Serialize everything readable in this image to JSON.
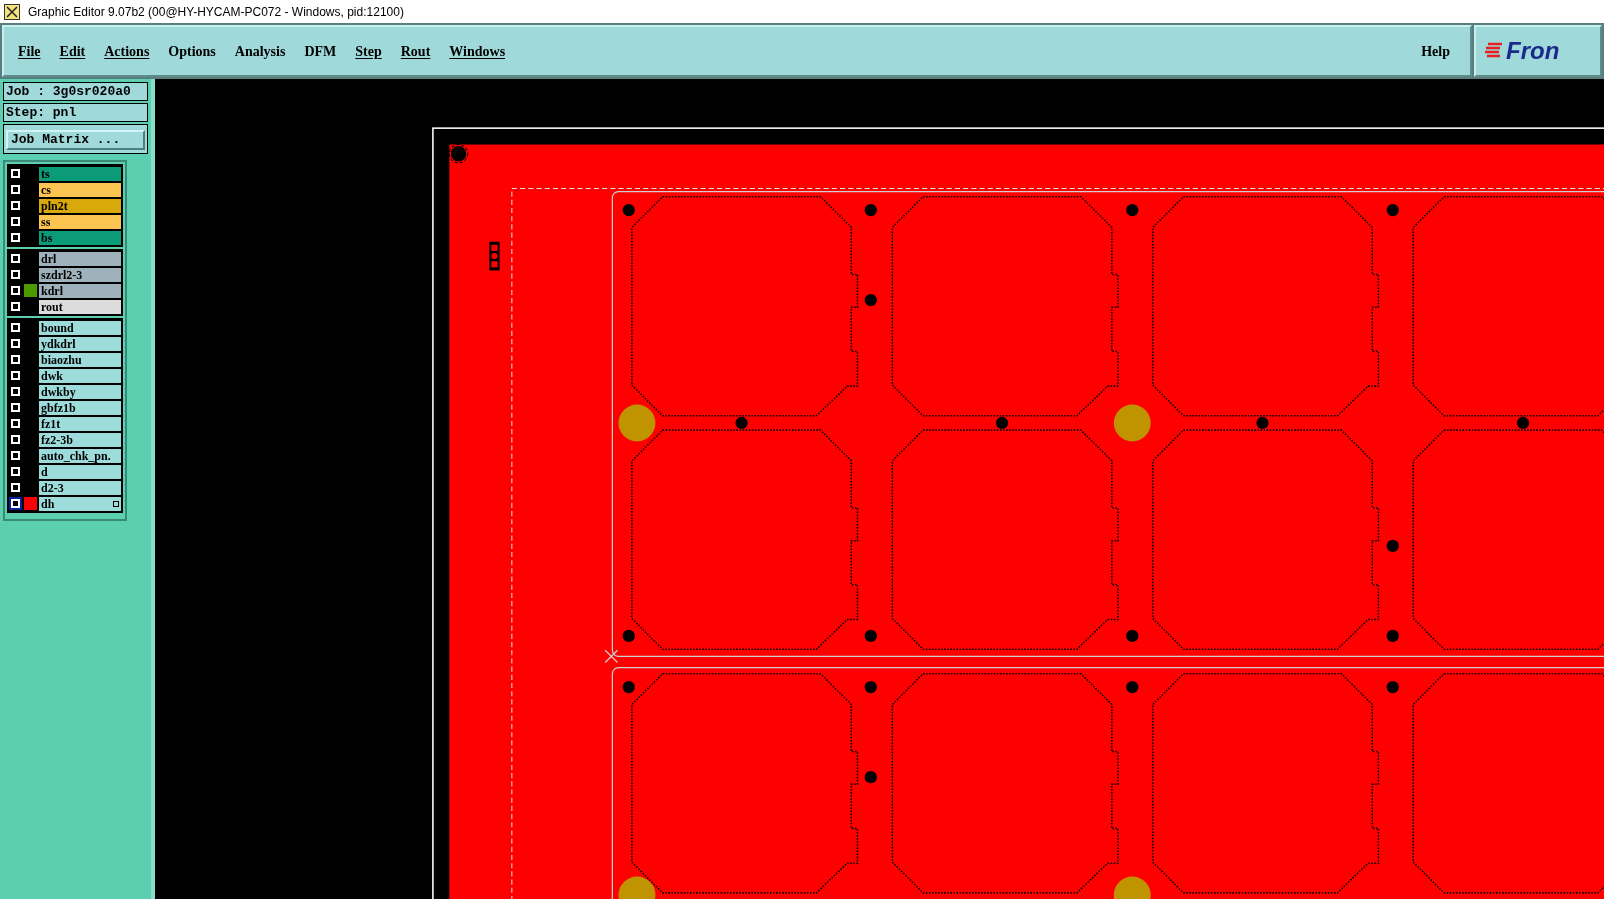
{
  "window": {
    "title": "Graphic Editor 9.07b2 (00@HY-HYCAM-PC072 - Windows, pid:12100)"
  },
  "menu": [
    {
      "label": "File",
      "underline": true
    },
    {
      "label": "Edit",
      "underline": true
    },
    {
      "label": "Actions",
      "underline": true
    },
    {
      "label": "Options",
      "underline": false
    },
    {
      "label": "Analysis",
      "underline": false
    },
    {
      "label": "DFM",
      "underline": false
    },
    {
      "label": "Step",
      "underline": true
    },
    {
      "label": "Rout",
      "underline": true
    },
    {
      "label": "Windows",
      "underline": true
    }
  ],
  "help": "Help",
  "logo": "Fron",
  "job": "Job : 3g0sr020a0",
  "step": "Step: pnl",
  "job_matrix_button": "Job Matrix ...",
  "layer_groups": [
    {
      "layers": [
        {
          "name": "ts",
          "color": "#0c9b78",
          "selected": false
        },
        {
          "name": "cs",
          "color": "#fcc451",
          "selected": false
        },
        {
          "name": "pln2t",
          "color": "#d9a90c",
          "selected": false
        },
        {
          "name": "ss",
          "color": "#fcc451",
          "selected": false
        },
        {
          "name": "bs",
          "color": "#0c9b78",
          "selected": false
        }
      ]
    },
    {
      "layers": [
        {
          "name": "drl",
          "color": "#9fb1ba",
          "selected": false
        },
        {
          "name": "szdrl2-3",
          "color": "#9fb1ba",
          "selected": false
        },
        {
          "name": "kdrl",
          "color": "#9fb1ba",
          "selected": false,
          "swatch": {
            "color": "#4a9a00"
          }
        },
        {
          "name": "rout",
          "color": "#dcdcdc",
          "selected": false
        }
      ]
    },
    {
      "layers": [
        {
          "name": "bound",
          "color": "#9edcdc",
          "selected": false
        },
        {
          "name": "ydkdrl",
          "color": "#9edcdc",
          "selected": false
        },
        {
          "name": "biaozhu",
          "color": "#9edcdc",
          "selected": false
        },
        {
          "name": "dwk",
          "color": "#9edcdc",
          "selected": false
        },
        {
          "name": "dwkby",
          "color": "#9edcdc",
          "selected": false
        },
        {
          "name": "gbfz1b",
          "color": "#9edcdc",
          "selected": false
        },
        {
          "name": "fz1t",
          "color": "#9edcdc",
          "selected": false
        },
        {
          "name": "fz2-3b",
          "color": "#9edcdc",
          "selected": false
        },
        {
          "name": "auto_chk_pn.",
          "color": "#9edcdc",
          "selected": false
        },
        {
          "name": "d",
          "color": "#9edcdc",
          "selected": false
        },
        {
          "name": "d2-3",
          "color": "#9edcdc",
          "selected": false
        },
        {
          "name": "dh",
          "color": "#9edcdc",
          "selected": true,
          "swatch": {
            "color": "#ff0000"
          }
        }
      ]
    }
  ]
}
